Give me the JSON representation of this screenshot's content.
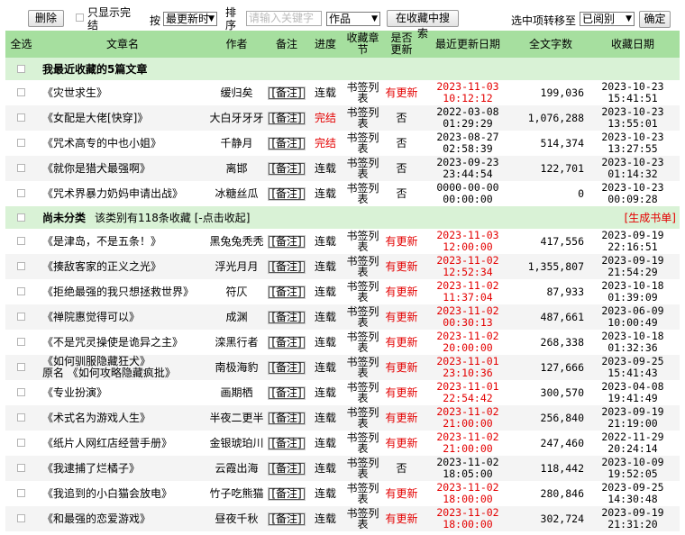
{
  "toolbar": {
    "delete_label": "删除",
    "only_show_completed": "只显示完结",
    "sort_by_label": "按",
    "sort_selected": "最更新时",
    "sort_label": "排序",
    "search_placeholder": "请输入关键字",
    "search_type": "作品",
    "search_button": "在收藏中搜索",
    "move_label": "选中项转移至",
    "move_target": "已阅别",
    "confirm_button": "确定"
  },
  "columns": [
    "全选",
    "文章名",
    "作者",
    "备注",
    "进度",
    "收藏章节",
    "是否更新",
    "最近更新日期",
    "全文字数",
    "收藏日期"
  ],
  "section_recent": {
    "title": "我最近收藏的5篇文章"
  },
  "recent_rows": [
    {
      "title": "《灾世求生》",
      "author": "缓归矣",
      "note": "[备注]",
      "status": "连载",
      "status_red": false,
      "chapters": "书签列表",
      "update": "有更新",
      "update_red": true,
      "date": "2023-11-03 10:12:12",
      "date_red": true,
      "words": "199,036",
      "fav_date": "2023-10-23 15:41:51"
    },
    {
      "title": "《女配是大佬[快穿]》",
      "author": "大白牙牙牙",
      "note": "[备注]",
      "status": "完结",
      "status_red": true,
      "chapters": "书签列表",
      "update": "否",
      "update_red": false,
      "date": "2022-03-08 01:29:29",
      "date_red": false,
      "words": "1,076,288",
      "fav_date": "2023-10-23 13:55:01"
    },
    {
      "title": "《咒术高专的中也小姐》",
      "author": "千静月",
      "note": "[备注]",
      "status": "完结",
      "status_red": true,
      "chapters": "书签列表",
      "update": "否",
      "update_red": false,
      "date": "2023-08-27 02:58:39",
      "date_red": false,
      "words": "514,374",
      "fav_date": "2023-10-23 13:27:55"
    },
    {
      "title": "《就你是猎犬最强啊》",
      "author": "离邯",
      "note": "[备注]",
      "status": "连载",
      "status_red": false,
      "chapters": "书签列表",
      "update": "否",
      "update_red": false,
      "date": "2023-09-23 23:44:54",
      "date_red": false,
      "words": "122,701",
      "fav_date": "2023-10-23 01:14:32"
    },
    {
      "title": "《咒术界暴力奶妈申请出战》",
      "author": "冰糖丝瓜",
      "note": "[备注]",
      "status": "连载",
      "status_red": false,
      "chapters": "书签列表",
      "update": "否",
      "update_red": false,
      "date": "0000-00-00 00:00:00",
      "date_red": false,
      "words": "0",
      "fav_date": "2023-10-23 00:09:28"
    }
  ],
  "section_uncat": {
    "title": "尚未分类",
    "info": "该类别有118条收藏 [-点击收起]",
    "gen_list": "[生成书单]"
  },
  "uncat_rows": [
    {
      "title": "《是津岛，不是五条！》",
      "alt": "",
      "author": "黑兔兔秃秃",
      "note": "[备注]",
      "status": "连载",
      "chapters": "书签列表",
      "update": "有更新",
      "update_red": true,
      "date": "2023-11-03 12:00:00",
      "words": "417,556",
      "fav_date": "2023-09-19 22:16:51"
    },
    {
      "title": "《揍敌客家的正义之光》",
      "alt": "",
      "author": "浮光月月",
      "note": "[备注]",
      "status": "连载",
      "chapters": "书签列表",
      "update": "有更新",
      "update_red": true,
      "date": "2023-11-02 12:52:34",
      "words": "1,355,807",
      "fav_date": "2023-09-19 21:54:29"
    },
    {
      "title": "《拒绝最强的我只想拯救世界》",
      "alt": "",
      "author": "符仄",
      "note": "[备注]",
      "status": "连载",
      "chapters": "书签列表",
      "update": "有更新",
      "update_red": true,
      "date": "2023-11-02 11:37:04",
      "words": "87,933",
      "fav_date": "2023-10-18 01:39:09"
    },
    {
      "title": "《禅院惠觉得可以》",
      "alt": "",
      "author": "成渊",
      "note": "[备注]",
      "status": "连载",
      "chapters": "书签列表",
      "update": "有更新",
      "update_red": true,
      "date": "2023-11-02 00:30:13",
      "words": "487,661",
      "fav_date": "2023-06-09 10:00:49"
    },
    {
      "title": "《不是咒灵操使是诡异之主》",
      "alt": "",
      "author": "滦黑行者",
      "note": "[备注]",
      "status": "连载",
      "chapters": "书签列表",
      "update": "有更新",
      "update_red": true,
      "date": "2023-11-02 20:00:00",
      "words": "268,338",
      "fav_date": "2023-10-18 01:32:36"
    },
    {
      "title": "《如何驯服隐藏狂犬》",
      "alt": "原名 《如何攻略隐藏疯批》",
      "author": "南极海豹",
      "note": "[备注]",
      "status": "连载",
      "chapters": "书签列表",
      "update": "有更新",
      "update_red": true,
      "date": "2023-11-01 23:10:36",
      "words": "127,666",
      "fav_date": "2023-09-25 15:41:43"
    },
    {
      "title": "《专业扮演》",
      "alt": "",
      "author": "画期栖",
      "note": "[备注]",
      "status": "连载",
      "chapters": "书签列表",
      "update": "有更新",
      "update_red": true,
      "date": "2023-11-01 22:54:42",
      "words": "300,570",
      "fav_date": "2023-04-08 19:41:49"
    },
    {
      "title": "《术式名为游戏人生》",
      "alt": "",
      "author": "半夜二更半",
      "note": "[备注]",
      "status": "连载",
      "chapters": "书签列表",
      "update": "有更新",
      "update_red": true,
      "date": "2023-11-02 21:00:00",
      "words": "256,840",
      "fav_date": "2023-09-19 21:19:00"
    },
    {
      "title": "《纸片人网红店经营手册》",
      "alt": "",
      "author": "金银琥珀川",
      "note": "[备注]",
      "status": "连载",
      "chapters": "书签列表",
      "update": "有更新",
      "update_red": true,
      "date": "2023-11-02 21:00:00",
      "words": "247,460",
      "fav_date": "2022-11-29 20:24:14"
    },
    {
      "title": "《我逮捕了烂橘子》",
      "alt": "",
      "author": "云霞出海",
      "note": "[备注]",
      "status": "连载",
      "chapters": "书签列表",
      "update": "否",
      "update_red": false,
      "date": "2023-11-02 18:05:00",
      "words": "118,442",
      "fav_date": "2023-10-09 19:52:05"
    },
    {
      "title": "《我追到的小白猫会放电》",
      "alt": "",
      "author": "竹子吃熊猫",
      "note": "[备注]",
      "status": "连载",
      "chapters": "书签列表",
      "update": "有更新",
      "update_red": true,
      "date": "2023-11-02 18:00:00",
      "words": "280,846",
      "fav_date": "2023-09-25 14:30:48"
    },
    {
      "title": "《和最强的恋爱游戏》",
      "alt": "",
      "author": "昼夜千秋",
      "note": "[备注]",
      "status": "连载",
      "chapters": "书签列表",
      "update": "有更新",
      "update_red": true,
      "date": "2023-11-02 18:00:00",
      "words": "302,724",
      "fav_date": "2023-09-19 21:31:20"
    }
  ],
  "colors": {
    "header_bg": "#a6df9f",
    "section_bg": "#d9f2d6",
    "alt_row_bg": "#f4f4f4",
    "accent_red": "#e40000"
  }
}
